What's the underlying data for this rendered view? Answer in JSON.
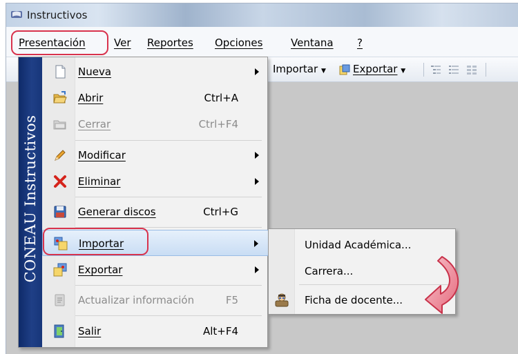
{
  "window": {
    "title": "Instructivos"
  },
  "menubar": {
    "items": [
      {
        "label": "Presentación"
      },
      {
        "label": "Ver"
      },
      {
        "label": "Reportes"
      },
      {
        "label": "Opciones"
      },
      {
        "label": "Ventana"
      },
      {
        "label": "?"
      }
    ]
  },
  "toolbar": {
    "importar_label": "Importar",
    "exportar_label": "Exportar"
  },
  "side_banner": "CONEAU  Instructivos",
  "menu": {
    "items": [
      {
        "label": "Nueva",
        "shortcut": "",
        "icon": "new-document-icon",
        "submenu": true
      },
      {
        "label": "Abrir",
        "shortcut": "Ctrl+A",
        "icon": "open-folder-icon"
      },
      {
        "label": "Cerrar",
        "shortcut": "Ctrl+F4",
        "icon": "close-folder-icon",
        "disabled": true
      },
      {
        "label": "Modificar",
        "shortcut": "",
        "icon": "pencil-icon",
        "submenu": true
      },
      {
        "label": "Eliminar",
        "shortcut": "",
        "icon": "red-x-icon",
        "submenu": true
      },
      {
        "label": "Generar discos",
        "shortcut": "Ctrl+G",
        "icon": "floppy-disk-icon"
      },
      {
        "label": "Importar",
        "shortcut": "",
        "icon": "import-icon",
        "submenu": true,
        "selected": true
      },
      {
        "label": "Exportar",
        "shortcut": "",
        "icon": "export-icon",
        "submenu": true
      },
      {
        "label": "Actualizar información",
        "shortcut": "F5",
        "icon": "update-icon",
        "disabled": true
      },
      {
        "label": "Salir",
        "shortcut": "Alt+F4",
        "icon": "exit-door-icon"
      }
    ]
  },
  "submenu": {
    "items": [
      {
        "label": "Unidad Académica..."
      },
      {
        "label": "Carrera..."
      },
      {
        "label": "Ficha de docente...",
        "icon": "teacher-icon"
      }
    ]
  },
  "colors": {
    "banner": "#1f3f86",
    "highlight_annotation": "#d8324c",
    "selected_item": "#c9ddf4"
  }
}
